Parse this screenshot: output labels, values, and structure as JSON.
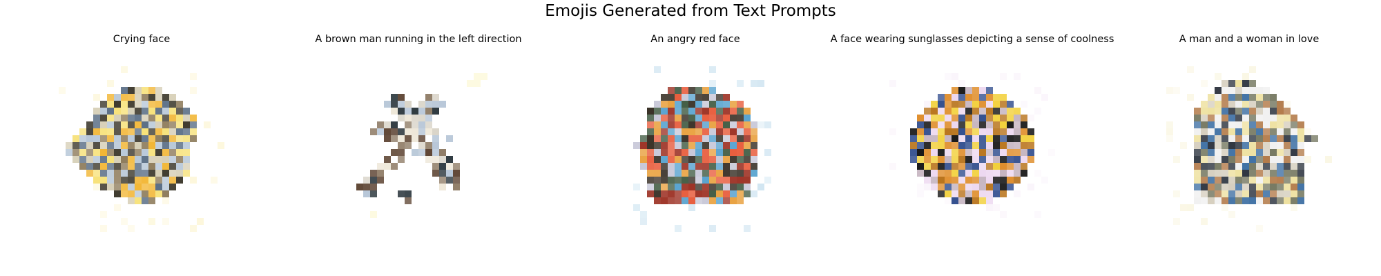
{
  "figure": {
    "title": "Emojis Generated from Text Prompts"
  },
  "panels": [
    {
      "title": "Crying face",
      "palette": [
        "#f2b634",
        "#3e3a2e",
        "#8f7d5d",
        "#d7d0b8",
        "#b8c8d8",
        "#5b6f86",
        "#f7e27a",
        "#ffffff"
      ]
    },
    {
      "title": "A brown man running in the left direction",
      "palette": [
        "#5f4635",
        "#8f7c66",
        "#d8d3c7",
        "#b8c7d8",
        "#2f3a40",
        "#eee7d8",
        "#ffffff",
        "#f8f0a8"
      ]
    },
    {
      "title": "An angry red face",
      "palette": [
        "#e85d3d",
        "#9e3427",
        "#e9a241",
        "#435d45",
        "#3a3228",
        "#c8c8d8",
        "#5aa4d0",
        "#ffffff"
      ]
    },
    {
      "title": "A face wearing sunglasses depicting a sense of coolness",
      "palette": [
        "#f2d03a",
        "#121212",
        "#b9751e",
        "#34508f",
        "#df8e2c",
        "#c6b5c1",
        "#edd8f0",
        "#ffffff"
      ]
    },
    {
      "title": "A man and a woman in love",
      "palette": [
        "#2f3641",
        "#777a63",
        "#d6cfbf",
        "#b37b4a",
        "#3d6fa3",
        "#f0f0f0",
        "#eee1a0",
        "#ffffff"
      ]
    }
  ]
}
